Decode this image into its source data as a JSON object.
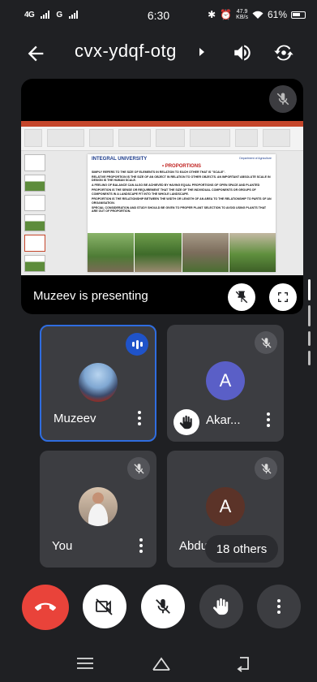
{
  "status_bar": {
    "network_left": "4G",
    "network_right": "G",
    "time": "6:30",
    "speed_value": "47.9",
    "speed_unit": "KB/s",
    "battery": "61%"
  },
  "header": {
    "meeting_code": "cvx-ydqf-otg"
  },
  "presentation": {
    "label": "Muzeev is presenting",
    "slide": {
      "logo": "INTEGRAL UNIVERSITY",
      "department": "Department of Agriculture",
      "heading": "• PROPORTIONS",
      "lines": [
        "Simply refers to the size of elements in relation to each other that is \"scale\".",
        "Relative proportion is the size of an object in relation to other objects. An important absolute scale in design is the human scale.",
        "A feeling of balance can also be achieved by having equal proportions of open space and planted",
        "Proportion is the sense or requirement that the size of the individual components or groups of components in a landscape fit into the whole landscape.",
        "Proportion is the relationship between the width or length of an area to the relationship to parts of an organisation.",
        "Special consideration and study should be given to proper plant selection to avoid using plants that are out of proportion."
      ]
    }
  },
  "participants": [
    {
      "name": "Muzeev",
      "avatar": "photo",
      "status": "speaking"
    },
    {
      "name": "Akar...",
      "avatar_letter": "A",
      "avatar_color": "#5a5fc7",
      "status": "muted",
      "hand_raised": true
    },
    {
      "name": "You",
      "avatar": "photo",
      "status": "muted"
    },
    {
      "name": "Abdul",
      "avatar_letter": "A",
      "avatar_color": "#5b3328",
      "status": "muted"
    }
  ],
  "others_count_label": "18 others",
  "controls": {
    "end_call": "end-call-icon",
    "camera": "camera-off-icon",
    "mic": "mic-off-icon",
    "raise_hand": "hand-icon",
    "more": "more-vert-icon"
  },
  "colors": {
    "end_call": "#e9433a",
    "active_border": "#2f6de0",
    "speaking_badge": "#1f53c9",
    "tile_bg": "#3c3d41",
    "page_bg": "#1f2023"
  }
}
